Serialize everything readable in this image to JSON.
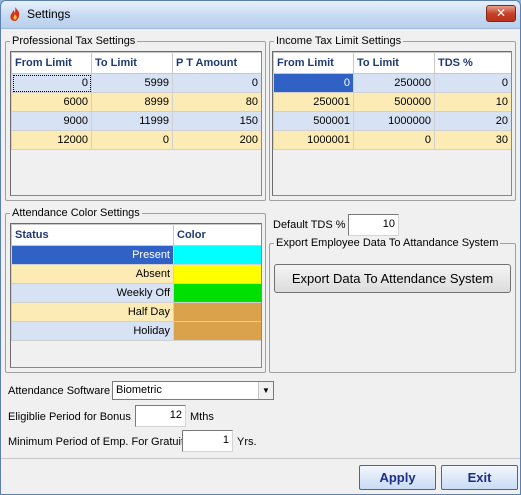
{
  "window": {
    "title": "Settings",
    "close_label": "✕",
    "icon": "app-flame-icon"
  },
  "professional_tax": {
    "legend": "Professional Tax Settings",
    "columns": [
      "From Limit",
      "To Limit",
      "P T Amount"
    ],
    "rows": [
      [
        "0",
        "5999",
        "0"
      ],
      [
        "6000",
        "8999",
        "80"
      ],
      [
        "9000",
        "11999",
        "150"
      ],
      [
        "12000",
        "0",
        "200"
      ]
    ]
  },
  "income_tax": {
    "legend": "Income Tax Limit Settings",
    "columns": [
      "From Limit",
      "To Limit",
      "TDS %"
    ],
    "rows": [
      [
        "0",
        "250000",
        "0"
      ],
      [
        "250001",
        "500000",
        "10"
      ],
      [
        "500001",
        "1000000",
        "20"
      ],
      [
        "1000001",
        "0",
        "30"
      ]
    ]
  },
  "attendance_color": {
    "legend": "Attendance Color Settings",
    "columns": [
      "Status",
      "Color"
    ],
    "rows": [
      {
        "status": "Present",
        "color": "#00ffff"
      },
      {
        "status": "Absent",
        "color": "#ffff00"
      },
      {
        "status": "Weekly Off",
        "color": "#00e000"
      },
      {
        "status": "Half Day",
        "color": "#daa24a"
      },
      {
        "status": "Holiday",
        "color": "#daa24a"
      }
    ]
  },
  "default_tds": {
    "label": "Default TDS %",
    "value": "10"
  },
  "export": {
    "legend": "Export Employee Data To Attandance System",
    "button_label": "Export Data To Attendance System"
  },
  "attendance_software": {
    "label": "Attendance Software",
    "value": "Biometric"
  },
  "bonus": {
    "label": "Eligiblie Period for Bonus",
    "value": "12",
    "unit": "Mths"
  },
  "gratuity": {
    "label": "Minimum Period of Emp. For Gratuity",
    "value": "1",
    "unit": "Yrs."
  },
  "footer": {
    "apply_label": "Apply",
    "exit_label": "Exit"
  },
  "colors": {
    "row_odd": "#d7e2f4",
    "row_even": "#fdebb5",
    "selection": "#2f62c4",
    "header_text": "#1f3a73"
  }
}
